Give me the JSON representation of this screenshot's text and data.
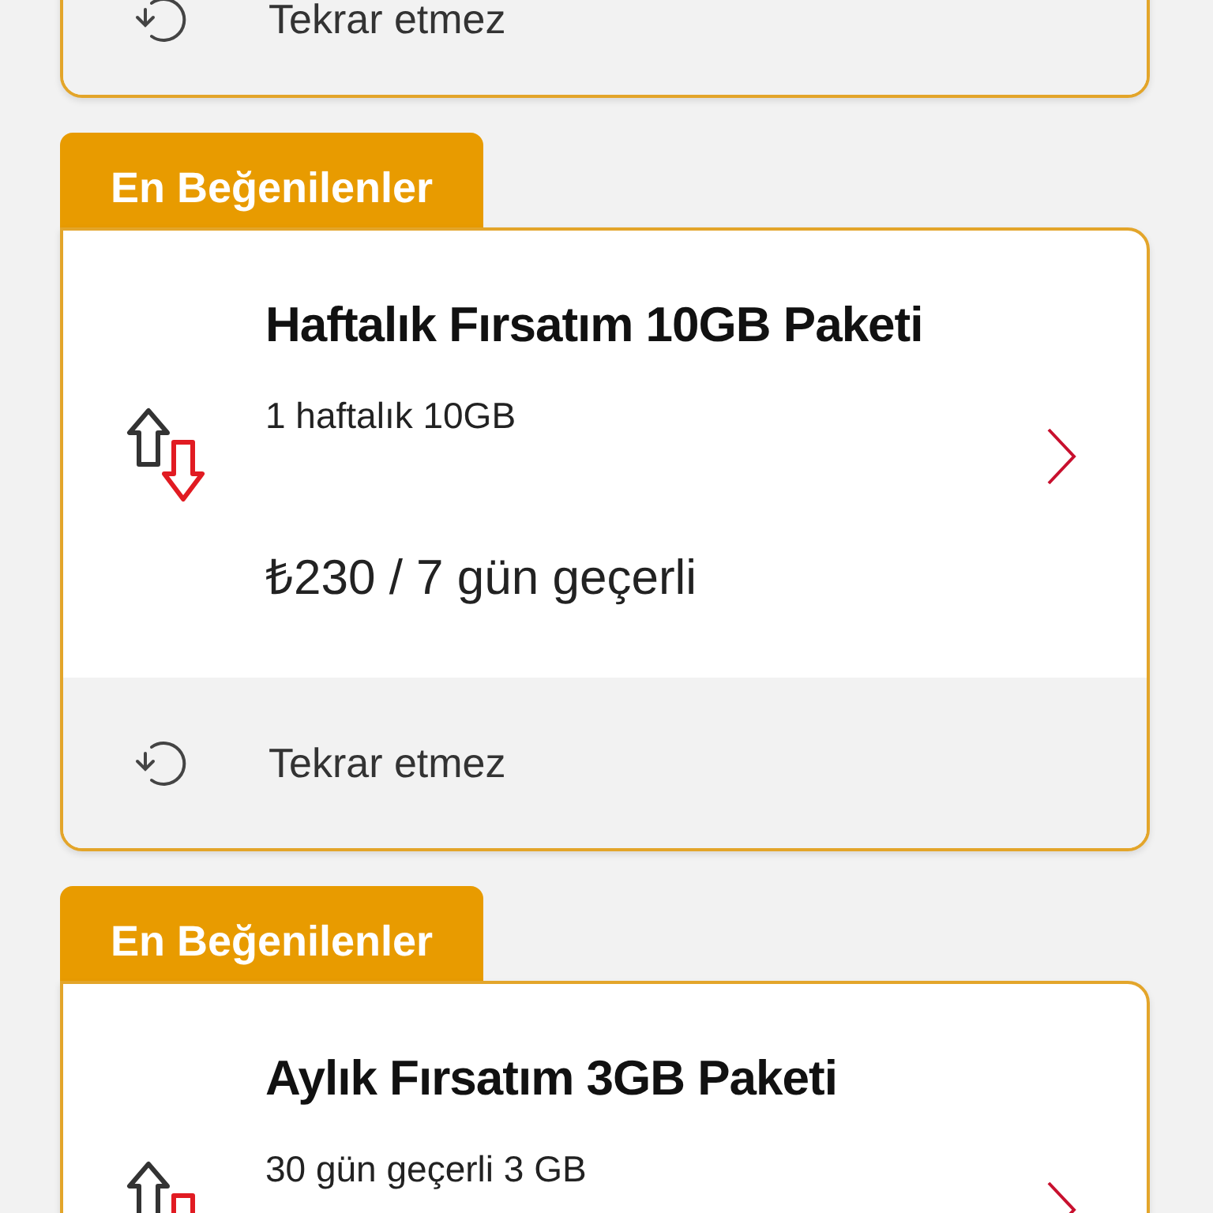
{
  "packages": [
    {
      "repeat": "Tekrar etmez"
    },
    {
      "badge": "En Beğenilenler",
      "title": "Haftalık Fırsatım 10GB Paketi",
      "subtitle": "1 haftalık 10GB",
      "price": "₺230 / 7 gün geçerli",
      "repeat": "Tekrar etmez"
    },
    {
      "badge": "En Beğenilenler",
      "title": "Aylık Fırsatım 3GB Paketi",
      "subtitle": "30 gün geçerli 3 GB"
    }
  ]
}
